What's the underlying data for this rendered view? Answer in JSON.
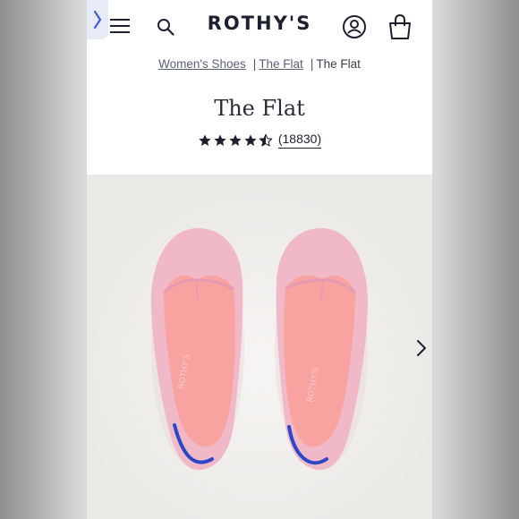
{
  "header": {
    "brand": "ROTHY'S",
    "icons": [
      "back-chevron-icon",
      "menu-icon",
      "search-icon",
      "account-icon",
      "shopping-bag-icon"
    ]
  },
  "breadcrumb": {
    "items": [
      {
        "label": "Women's Shoes"
      },
      {
        "label": "The Flat"
      },
      {
        "label": "The Flat"
      }
    ],
    "separator": "|"
  },
  "product": {
    "title": "The Flat",
    "rating": 4.5,
    "review_count": "(18830)",
    "shoe_label": "ROTHY'S",
    "gallery_next_icon": "chevron-right-icon"
  },
  "colors": {
    "brand_navy": "#1d2030",
    "shoe_pink": "#f1b8c8",
    "insole_salmon": "#f8a3a0",
    "accent_blue": "#2b47c8"
  }
}
